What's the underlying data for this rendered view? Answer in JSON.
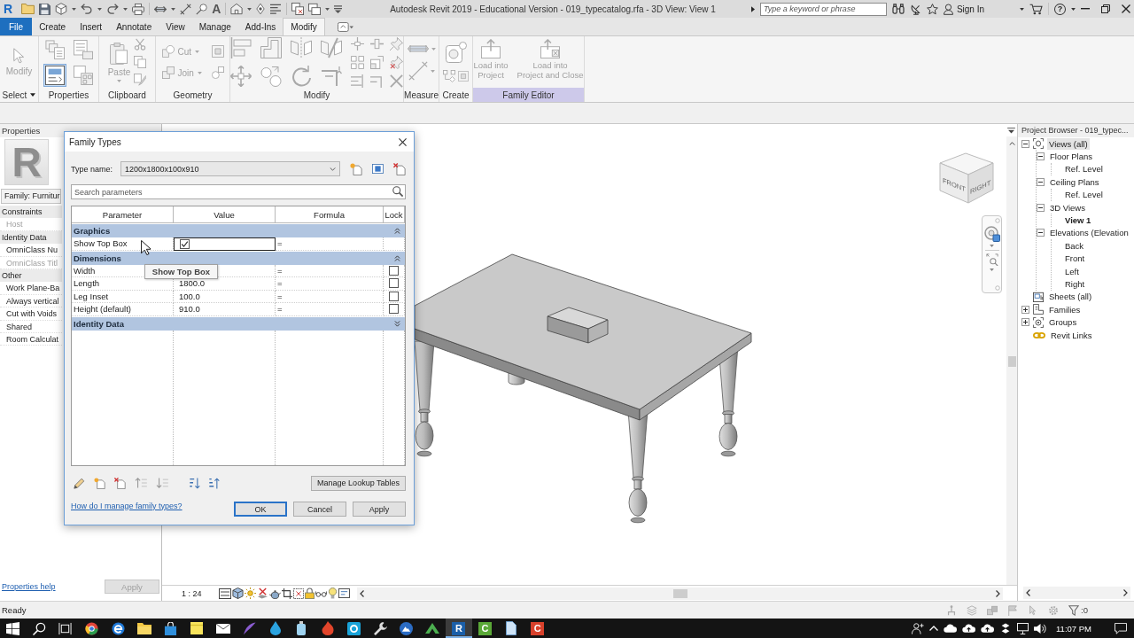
{
  "title_bar": {
    "logo": "R",
    "text_tool": "A",
    "title": "Autodesk Revit 2019 - Educational Version - 019_typecatalog.rfa - 3D View: View 1",
    "search": {
      "placeholder": "Type a keyword or phrase"
    },
    "sign_in": "Sign In",
    "help": "?"
  },
  "ribbon": {
    "tabs": [
      {
        "label": "File",
        "kind": "application",
        "selected": false
      },
      {
        "label": "Create",
        "kind": "tab",
        "selected": false
      },
      {
        "label": "Insert",
        "kind": "tab",
        "selected": false
      },
      {
        "label": "Annotate",
        "kind": "tab",
        "selected": false
      },
      {
        "label": "View",
        "kind": "tab",
        "selected": false
      },
      {
        "label": "Manage",
        "kind": "tab",
        "selected": false
      },
      {
        "label": "Add-Ins",
        "kind": "tab",
        "selected": false
      },
      {
        "label": "Modify",
        "kind": "tab",
        "selected": true
      }
    ],
    "panels": [
      {
        "kind": "select",
        "label": "Select",
        "dropdown": true,
        "contextual": false,
        "buttons": [
          {
            "label": "Modify",
            "disabled": true
          }
        ]
      },
      {
        "kind": "properties",
        "label": "Properties",
        "dropdown": false,
        "contextual": false,
        "tools": [
          {
            "active": false
          },
          {
            "active": false
          },
          {
            "active": true
          },
          {
            "active": false
          }
        ]
      },
      {
        "kind": "clipboard",
        "label": "Clipboard",
        "dropdown": false,
        "contextual": false,
        "buttons": [
          {
            "label": "Paste",
            "disabled": true
          }
        ]
      },
      {
        "kind": "geometry",
        "label": "Geometry",
        "dropdown": false,
        "contextual": false,
        "buttons": [
          {
            "label": "Cut",
            "disabled": true
          },
          {
            "label": "Join",
            "disabled": true
          }
        ]
      },
      {
        "kind": "modify",
        "label": "Modify",
        "dropdown": false,
        "contextual": false
      },
      {
        "kind": "measure",
        "label": "Measure",
        "dropdown": false,
        "contextual": false
      },
      {
        "kind": "create",
        "label": "Create",
        "dropdown": false,
        "contextual": false
      },
      {
        "kind": "family_editor",
        "label": "Family Editor",
        "dropdown": false,
        "contextual": true,
        "buttons": [
          {
            "label": "Load into\nProject",
            "disabled": true
          },
          {
            "label": "Load into\nProject and Close",
            "disabled": true
          }
        ]
      }
    ]
  },
  "properties": {
    "title": "Properties",
    "type_image": "R",
    "type_selector": "Family: Furnitur",
    "groups": [
      {
        "label": "Constraints",
        "items": [
          {
            "label": "Host",
            "disabled": true
          }
        ]
      },
      {
        "label": "Identity Data",
        "items": [
          {
            "label": "OmniClass Nu",
            "disabled": false
          },
          {
            "label": "OmniClass Titl",
            "disabled": true
          }
        ]
      },
      {
        "label": "Other",
        "items": [
          {
            "label": "Work Plane-Ba",
            "disabled": false
          },
          {
            "label": "Always vertical",
            "disabled": false
          },
          {
            "label": "Cut with Voids",
            "disabled": false
          },
          {
            "label": "Shared",
            "disabled": false
          },
          {
            "label": "Room Calculat",
            "disabled": false
          }
        ]
      }
    ],
    "help_link": "Properties help",
    "apply": {
      "label": "Apply",
      "disabled": true
    }
  },
  "view": {
    "view_cube": {
      "front": "FRONT",
      "right": "RIGHT"
    },
    "scale": "1 : 24"
  },
  "project_browser": {
    "title": "Project Browser - 019_typec...",
    "tree": [
      {
        "label": "Views (all)",
        "kind": "views",
        "expanded": true,
        "selected": true,
        "current": false,
        "children": [
          {
            "label": "Floor Plans",
            "expanded": true,
            "selected": false,
            "current": false,
            "children": [
              {
                "label": "Ref. Level",
                "selected": false,
                "current": false
              }
            ]
          },
          {
            "label": "Ceiling Plans",
            "expanded": true,
            "selected": false,
            "current": false,
            "children": [
              {
                "label": "Ref. Level",
                "selected": false,
                "current": false
              }
            ]
          },
          {
            "label": "3D Views",
            "expanded": true,
            "selected": false,
            "current": false,
            "children": [
              {
                "label": "View 1",
                "selected": false,
                "current": true
              }
            ]
          },
          {
            "label": "Elevations (Elevation",
            "expanded": true,
            "selected": false,
            "current": false,
            "children": [
              {
                "label": "Back",
                "selected": false,
                "current": false
              },
              {
                "label": "Front",
                "selected": false,
                "current": false
              },
              {
                "label": "Left",
                "selected": false,
                "current": false
              },
              {
                "label": "Right",
                "selected": false,
                "current": false
              }
            ]
          }
        ]
      },
      {
        "label": "Sheets (all)",
        "kind": "sheets",
        "selected": false,
        "current": false
      },
      {
        "label": "Families",
        "kind": "families",
        "expanded": false,
        "selected": false,
        "current": false
      },
      {
        "label": "Groups",
        "kind": "groups",
        "expanded": false,
        "selected": false,
        "current": false
      },
      {
        "label": "Revit Links",
        "kind": "links",
        "selected": false,
        "current": false
      }
    ]
  },
  "family_types_dialog": {
    "title": "Family Types",
    "type_name_label": "Type name:",
    "type_name": "1200x1800x100x910",
    "search": {
      "placeholder": "Search parameters"
    },
    "columns": [
      "Parameter",
      "Value",
      "Formula",
      "Lock"
    ],
    "groups": [
      {
        "label": "Graphics",
        "expanded": true,
        "rows": [
          {
            "kind": "yes_no",
            "parameter": "Show Top Box",
            "checked": true,
            "formula": "=",
            "focused": true
          }
        ]
      },
      {
        "label": "Dimensions",
        "expanded": true,
        "rows": [
          {
            "kind": "length",
            "parameter": "Width",
            "formula": "=",
            "locked": false,
            "focused": false
          },
          {
            "kind": "length",
            "parameter": "Length",
            "value": "1800.0",
            "formula": "=",
            "locked": false,
            "focused": false
          },
          {
            "kind": "length",
            "parameter": "Leg Inset",
            "value": "100.0",
            "formula": "=",
            "locked": false,
            "focused": false
          },
          {
            "kind": "length",
            "parameter": "Height (default)",
            "value": "910.0",
            "formula": "=",
            "locked": false,
            "focused": false
          }
        ]
      },
      {
        "label": "Identity Data",
        "expanded": false
      }
    ],
    "tooltip": "Show Top Box",
    "lookup_button": "Manage Lookup Tables",
    "help_link": "How do I manage family types?",
    "buttons": [
      {
        "label": "OK",
        "default": true
      },
      {
        "label": "Cancel",
        "default": false
      },
      {
        "label": "Apply",
        "default": false
      }
    ]
  },
  "status_bar": {
    "text": "Ready",
    "selection_count": ":0"
  },
  "taskbar": {
    "letter_apps": [
      {
        "letter": "R",
        "color": "#1b5fa8",
        "selected": true
      },
      {
        "letter": "C",
        "color": "#5aa837",
        "selected": false
      },
      {
        "letter": "C",
        "color": "#d8412b",
        "selected": false
      }
    ],
    "clock": "11:07 PM"
  }
}
